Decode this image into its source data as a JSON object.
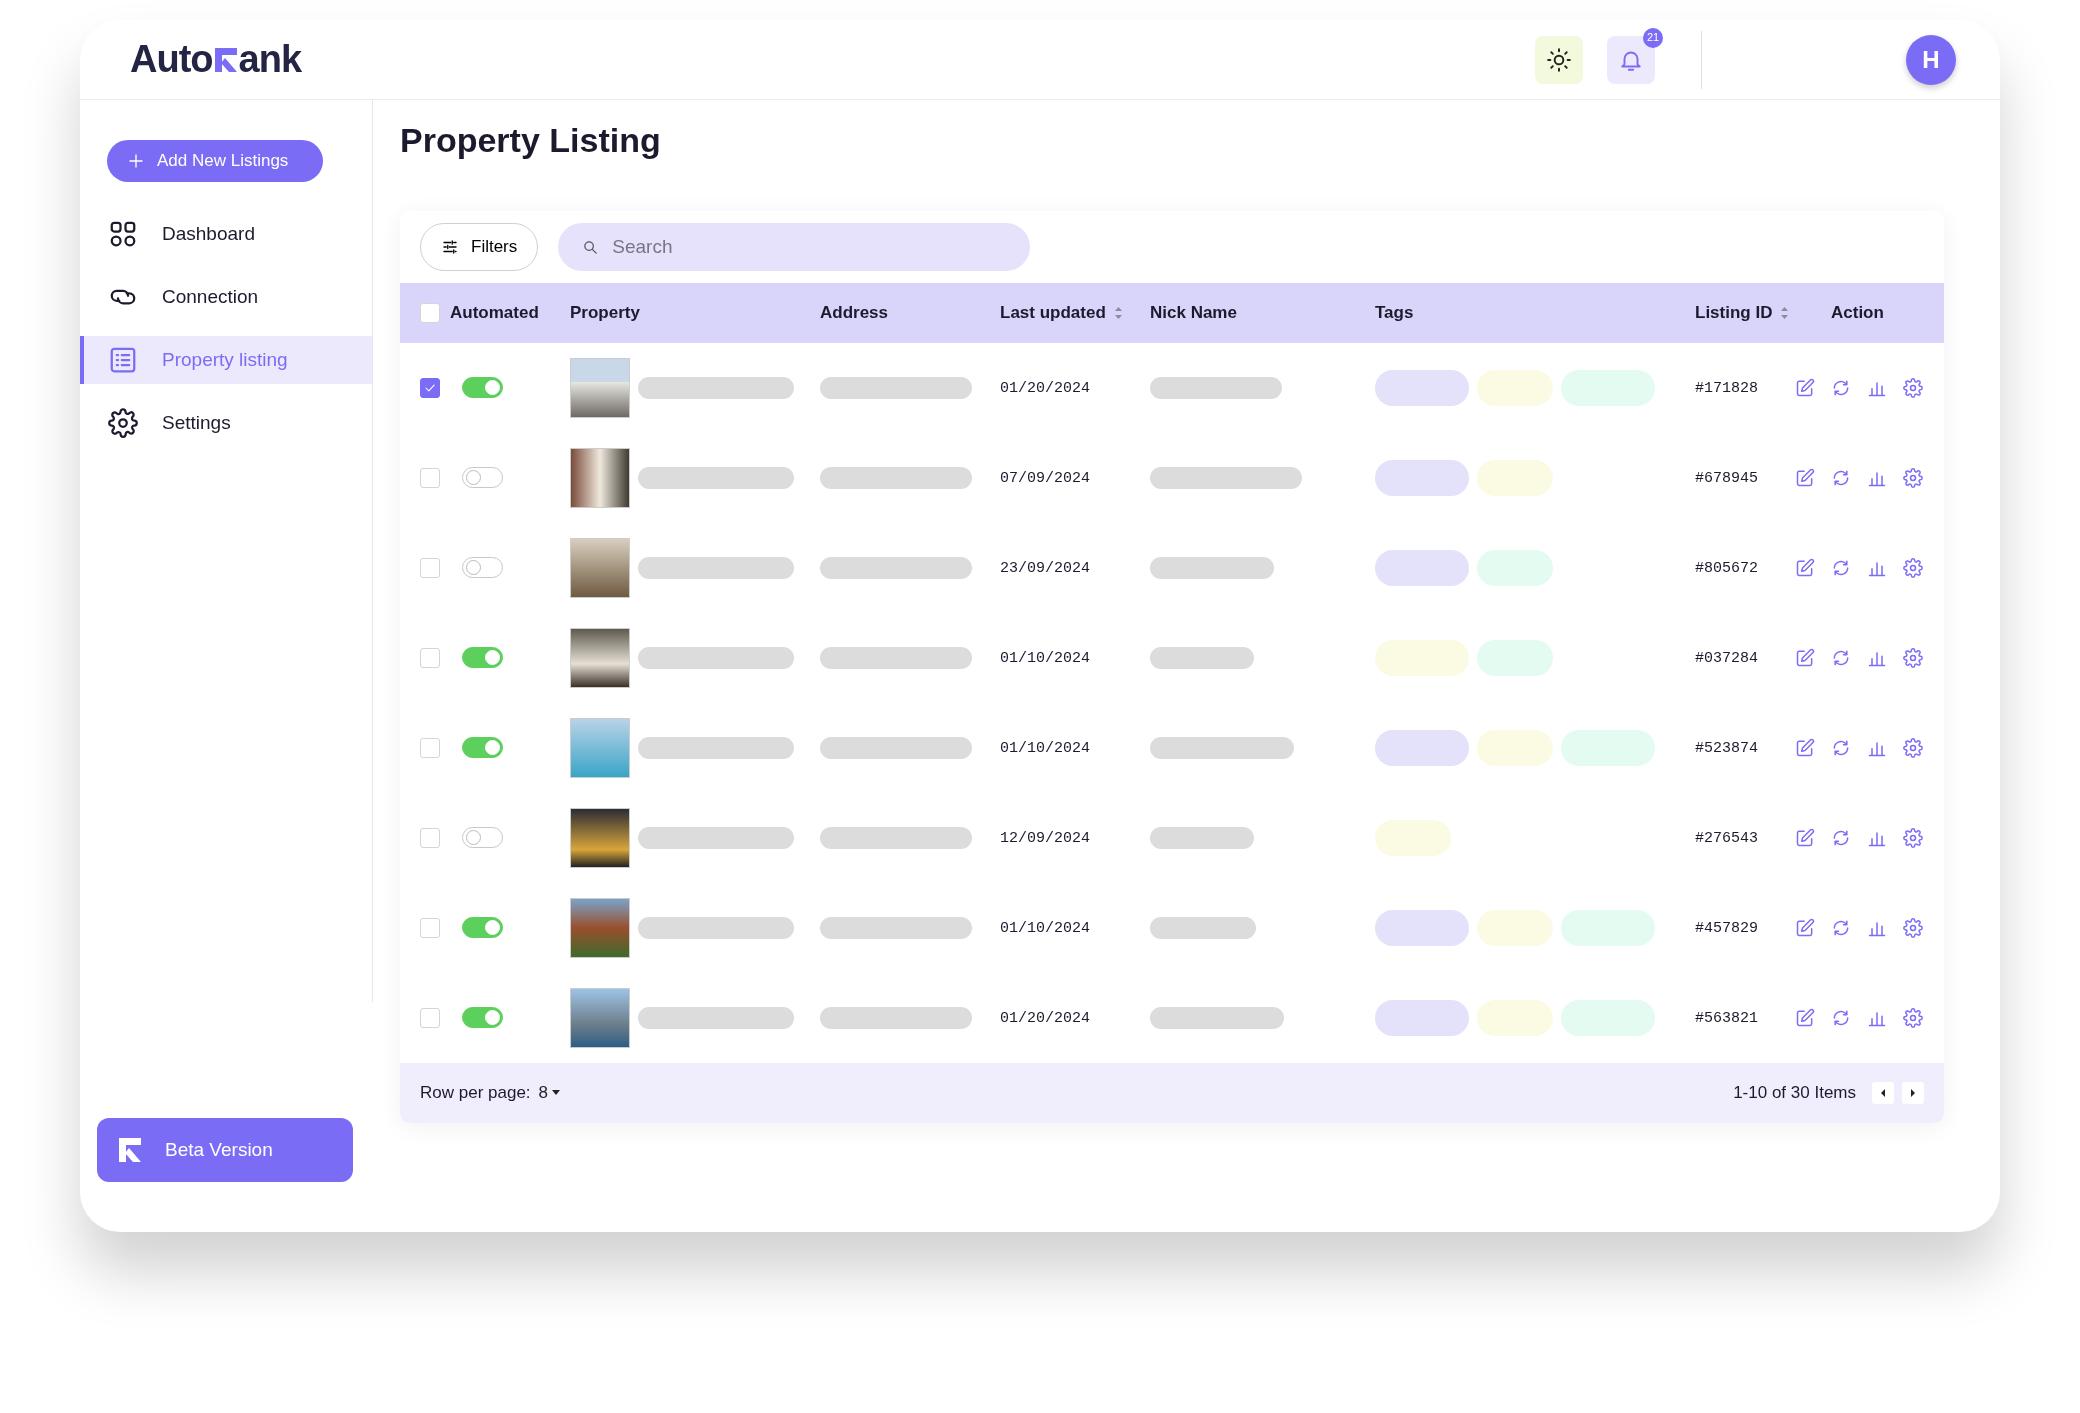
{
  "header": {
    "logo_start": "Auto",
    "logo_end": "ank",
    "notifications_badge": "21",
    "avatar_initial": "H"
  },
  "sidebar": {
    "add_button": "Add New Listings",
    "items": [
      {
        "label": "Dashboard",
        "selected": false
      },
      {
        "label": "Connection",
        "selected": false
      },
      {
        "label": "Property listing",
        "selected": true
      },
      {
        "label": "Settings",
        "selected": false
      }
    ],
    "beta_button": "Beta Version"
  },
  "page": {
    "title": "Property Listing"
  },
  "toolbar": {
    "filters_button": "Filters",
    "search": {
      "placeholder": "Search"
    }
  },
  "table": {
    "all_checked": false,
    "columns": [
      {
        "label": "Automated",
        "sortable": false
      },
      {
        "label": "Property",
        "sortable": false
      },
      {
        "label": "Address",
        "sortable": false
      },
      {
        "label": "Last updated",
        "sortable": true
      },
      {
        "label": "Nick Name",
        "sortable": false
      },
      {
        "label": "Tags",
        "sortable": false
      },
      {
        "label": "Listing ID",
        "sortable": true
      },
      {
        "label": "Action",
        "sortable": false
      }
    ],
    "rows": [
      {
        "checked": true,
        "automated": true,
        "last_updated": "01/20/2024",
        "listing_id": "#171828",
        "tags": [
          {
            "color": "#e4e1fb"
          },
          {
            "color": "#fbfbe3"
          },
          {
            "color": "#e3fbf1"
          }
        ]
      },
      {
        "checked": false,
        "automated": false,
        "last_updated": "07/09/2024",
        "listing_id": "#678945",
        "tags": [
          {
            "color": "#e4e1fb"
          },
          {
            "color": "#fbfbe3"
          }
        ]
      },
      {
        "checked": false,
        "automated": false,
        "last_updated": "23/09/2024",
        "listing_id": "#805672",
        "tags": [
          {
            "color": "#e4e1fb"
          },
          {
            "color": "#e3fbf1"
          }
        ]
      },
      {
        "checked": false,
        "automated": true,
        "last_updated": "01/10/2024",
        "listing_id": "#037284",
        "tags": [
          {
            "color": "#fbfbe3"
          },
          {
            "color": "#e3fbf1"
          }
        ]
      },
      {
        "checked": false,
        "automated": true,
        "last_updated": "01/10/2024",
        "listing_id": "#523874",
        "tags": [
          {
            "color": "#e4e1fb"
          },
          {
            "color": "#fbfbe3"
          },
          {
            "color": "#e3fbf1"
          }
        ]
      },
      {
        "checked": false,
        "automated": false,
        "last_updated": "12/09/2024",
        "listing_id": "#276543",
        "tags": [
          {
            "color": "#fbfbe3"
          }
        ]
      },
      {
        "checked": false,
        "automated": true,
        "last_updated": "01/10/2024",
        "listing_id": "#457829",
        "tags": [
          {
            "color": "#e4e1fb"
          },
          {
            "color": "#fbfbe3"
          },
          {
            "color": "#e3fbf1"
          }
        ]
      },
      {
        "checked": false,
        "automated": true,
        "last_updated": "01/20/2024",
        "listing_id": "#563821",
        "tags": [
          {
            "color": "#e4e1fb"
          },
          {
            "color": "#fbfbe3"
          },
          {
            "color": "#e3fbf1"
          }
        ]
      }
    ]
  },
  "footer": {
    "rows_label": "Row per page:",
    "rows_value": "8",
    "range": "1-10 of 30 Items"
  }
}
